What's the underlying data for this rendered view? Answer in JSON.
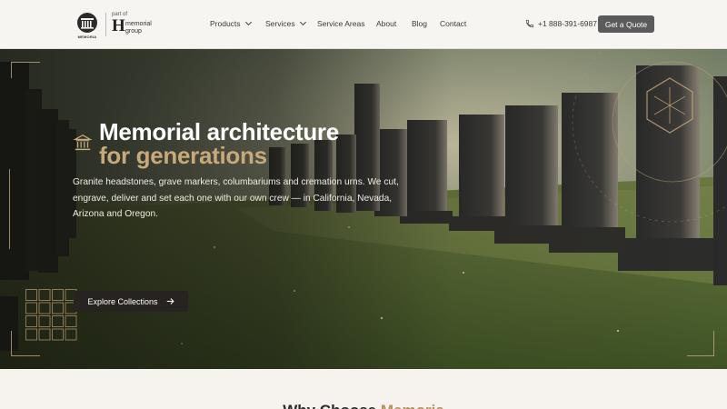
{
  "brand": {
    "logo_text": "MEMORIA",
    "part_of": "part of",
    "group_line1": "memorial",
    "group_line2": "group"
  },
  "nav": {
    "items": [
      {
        "label": "Products",
        "has_dropdown": true
      },
      {
        "label": "Services",
        "has_dropdown": true
      },
      {
        "label": "Service Areas",
        "has_dropdown": false
      },
      {
        "label": "About",
        "has_dropdown": false
      },
      {
        "label": "Blog",
        "has_dropdown": false
      },
      {
        "label": "Contact",
        "has_dropdown": false
      }
    ],
    "phone": "+1 888-391-6987",
    "cta_label": "Get a Quote"
  },
  "hero": {
    "title_line1": "Memorial architecture",
    "title_line2": "for generations",
    "description": "Granite headstones, grave markers, columbariums and cremation urns. We cut, engrave, deliver and set each one with our own crew — in California, Nevada, Arizona and Oregon.",
    "button_label": "Explore Collections"
  },
  "why": {
    "title_prefix": "Why Choose",
    "title_accent": "Memoria"
  },
  "colors": {
    "accent": "#c8a97a",
    "cta_bg": "#5b5b5b",
    "hero_button_bg": "#262320",
    "page_bg": "#f6f3ee"
  }
}
